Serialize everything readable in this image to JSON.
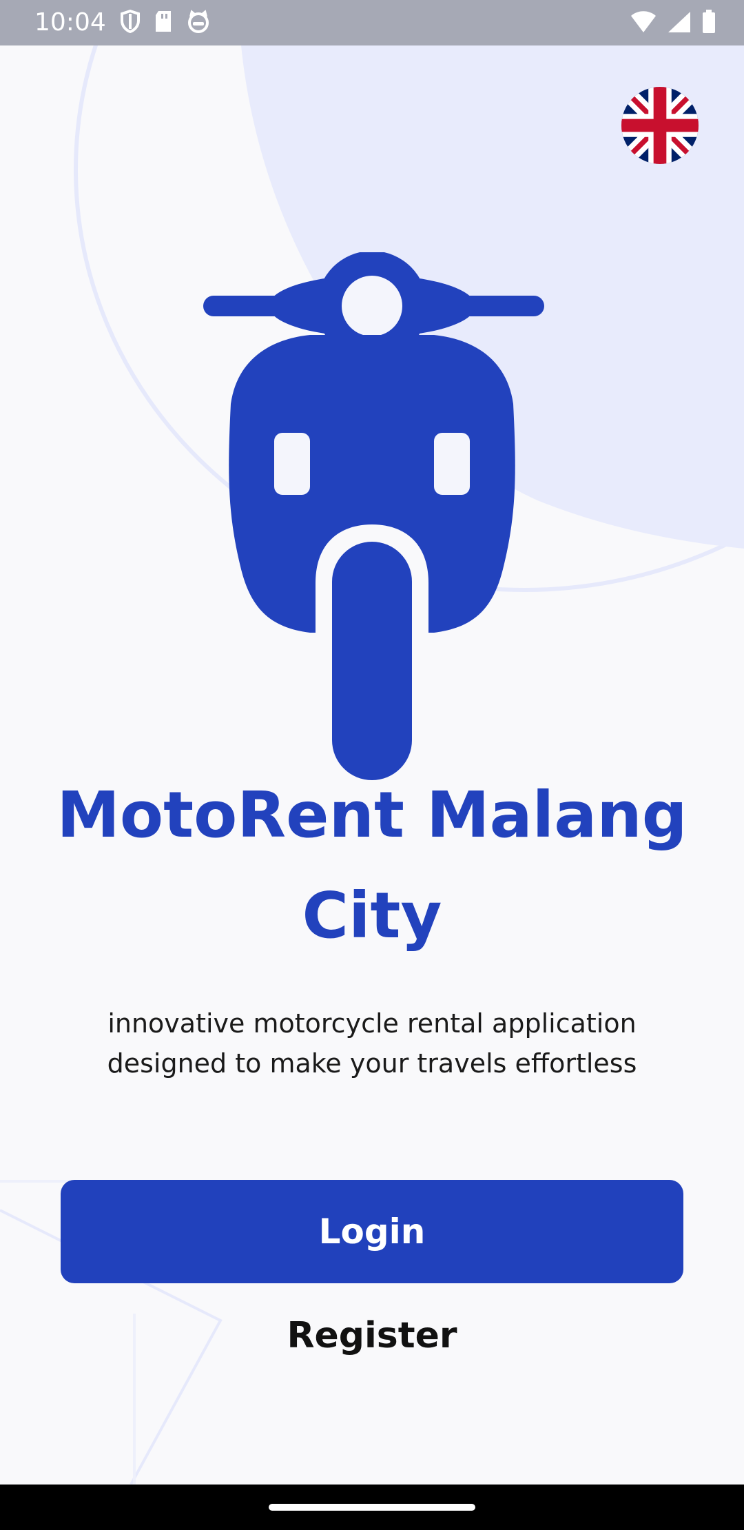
{
  "status_bar": {
    "time": "10:04",
    "icons_left": [
      "shield-icon",
      "sd-card-icon",
      "cat-icon"
    ],
    "icons_right": [
      "wifi-icon",
      "signal-icon",
      "battery-icon"
    ]
  },
  "language": {
    "selected": "English (UK)",
    "icon": "uk-flag-icon"
  },
  "app": {
    "title": "MotoRent Malang City",
    "subtitle": "innovative motorcycle rental application designed to make your travels effortless",
    "logo": "scooter-icon"
  },
  "actions": {
    "login_label": "Login",
    "register_label": "Register"
  },
  "colors": {
    "primary": "#2141BC",
    "background": "#F9F9FB",
    "accent_light": "#E9ECFB",
    "status_bar": "#A6A9B5"
  }
}
